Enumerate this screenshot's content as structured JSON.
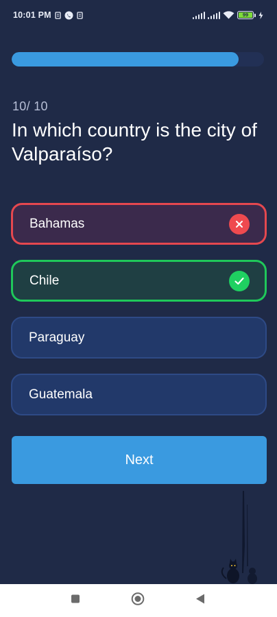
{
  "status_bar": {
    "time": "10:01 PM",
    "battery": "99"
  },
  "progress": {
    "fraction": 0.9
  },
  "quiz": {
    "counter": "10/ 10",
    "question": "In which country is the city of Valparaíso?",
    "options": [
      {
        "label": "Bahamas",
        "state": "wrong",
        "icon": "x-icon"
      },
      {
        "label": "Chile",
        "state": "correct",
        "icon": "check-icon"
      },
      {
        "label": "Paraguay",
        "state": "neutral"
      },
      {
        "label": "Guatemala",
        "state": "neutral"
      }
    ],
    "next_label": "Next"
  },
  "colors": {
    "background": "#1f2a47",
    "accent": "#3a9ae0",
    "wrong": "#e5484f",
    "correct": "#1fc85a"
  }
}
